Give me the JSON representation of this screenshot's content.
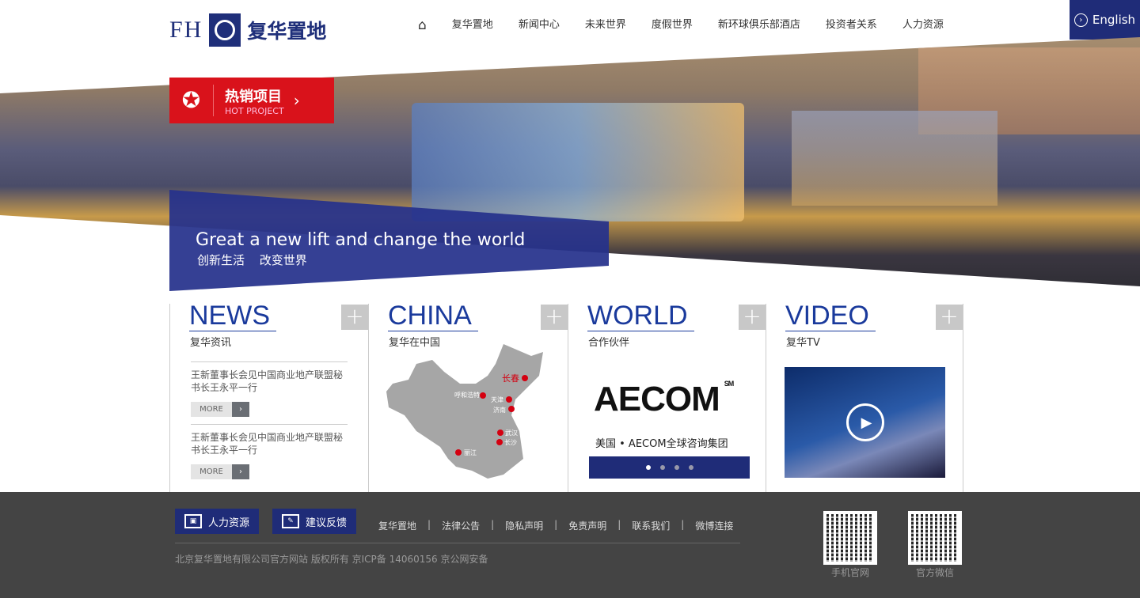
{
  "header": {
    "logo_latin": "FH",
    "logo_cn": "复华置地",
    "nav": [
      "复华置地",
      "新闻中心",
      "未来世界",
      "度假世界",
      "新环球俱乐部酒店",
      "投资者关系",
      "人力资源"
    ],
    "english": "English"
  },
  "hero": {
    "hot_cn": "热销项目",
    "hot_en": "HOT PROJECT",
    "slogan_en": "Great  a new lift and change the world",
    "slogan_cn": "创新生活 改变世界"
  },
  "news": {
    "title": "NEWS",
    "sub": "复华资讯",
    "items": [
      {
        "text": "王新董事长会见中国商业地产联盟秘书长王永平一行",
        "more": "MORE"
      },
      {
        "text": "王新董事长会见中国商业地产联盟秘书长王永平一行",
        "more": "MORE"
      }
    ]
  },
  "china": {
    "title": "CHINA",
    "sub": "复华在中国",
    "cities": [
      "长春",
      "呼和浩特",
      "天津",
      "济南",
      "武汉",
      "长沙",
      "丽江"
    ]
  },
  "world": {
    "title": "WORLD",
    "sub": "合作伙伴",
    "partner_logo": "AECOM",
    "partner_sm": "SM",
    "caption": "美国 • AECOM全球咨询集团",
    "slides": 4,
    "active_slide": 1
  },
  "video": {
    "title": "VIDEO",
    "sub": "复华TV"
  },
  "footer": {
    "btn_hr": "人力资源",
    "btn_feedback": "建议反馈",
    "links": [
      "复华置地",
      "法律公告",
      "隐私声明",
      "免责声明",
      "联系我们",
      "微博连接"
    ],
    "copyright": "北京复华置地有限公司官方网站  版权所有 京ICP备  14060156  京公网安备",
    "qr1": "手机官网",
    "qr2": "官方微信"
  },
  "colors": {
    "brand": "#1f2c78",
    "hot": "#d9121b",
    "title": "#1a3a9c"
  }
}
